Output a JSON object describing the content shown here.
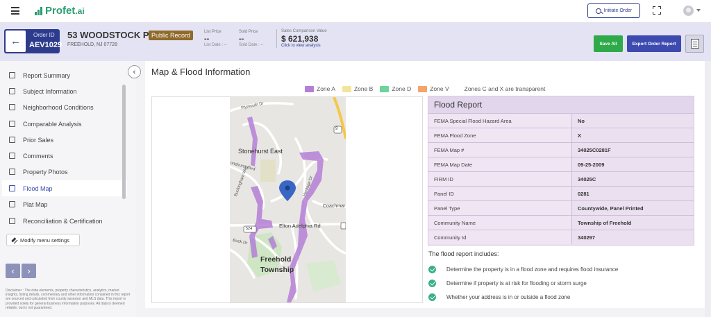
{
  "header": {
    "logo_text": "Profet",
    "logo_suffix": ".ai",
    "initiate_order_label": "Initiate Order"
  },
  "order": {
    "order_id_label": "Order ID",
    "order_id": "AEV1029",
    "address": "53 WOODSTOCK PL",
    "city": "FREEHOLD, NJ 07728",
    "badge": "Public Record",
    "list_price_label": "List Price",
    "list_price_value": "--",
    "list_date_label": "List Date : --",
    "sold_price_label": "Sold Price",
    "sold_price_value": "--",
    "sold_date_label": "Sold Date : --",
    "scv_label": "Sales Comparison Value",
    "scv_value": "$ 621,938",
    "scv_link": "Click to view analysis",
    "save_label": "Save All",
    "export_label": "Export Order Report"
  },
  "sidebar": {
    "items": [
      {
        "label": "Report Summary",
        "icon": "document-icon"
      },
      {
        "label": "Subject Information",
        "icon": "house-icon"
      },
      {
        "label": "Neighborhood Conditions",
        "icon": "neighborhood-icon"
      },
      {
        "label": "Comparable Analysis",
        "icon": "comparable-icon"
      },
      {
        "label": "Prior Sales",
        "icon": "history-icon"
      },
      {
        "label": "Comments",
        "icon": "comment-icon"
      },
      {
        "label": "Property Photos",
        "icon": "photo-icon"
      },
      {
        "label": "Flood Map",
        "icon": "flood-icon"
      },
      {
        "label": "Plat Map",
        "icon": "plat-icon"
      },
      {
        "label": "Reconciliation & Certification",
        "icon": "certificate-icon"
      }
    ],
    "active_index": 7,
    "modify_label": "Modify menu settings",
    "disclaimer": "Disclaimer : The data elements, property characteristics, analytics, market insights, listing details, commentary and other information contained in this report are sourced and calculated from county assessor and MLS data. This report is provided solely for general business information purposes. All data is deemed reliable, but is not guaranteed."
  },
  "main": {
    "title": "Map & Flood Information",
    "legend": [
      {
        "label": "Zone A",
        "color": "#b57fd6"
      },
      {
        "label": "Zone B",
        "color": "#f2e59b"
      },
      {
        "label": "Zone D",
        "color": "#6fd39a"
      },
      {
        "label": "Zone V",
        "color": "#f5a46a"
      }
    ],
    "legend_note": "Zones C and X are transparent",
    "map_labels": {
      "plymouth": "Plymouth Dr",
      "stonehurst": "Stonehurst East",
      "stonehurst_blvd": "onehurst Blvd",
      "buckingham": "Buckingham Way",
      "heritage": "Heritage Dr",
      "coachman": "Coachmar",
      "elton": "Elton Adelphia Rd",
      "route": "524",
      "buck": "Buck Dr",
      "township1": "Freehold",
      "township2": "Township",
      "highway": "9"
    }
  },
  "flood_report": {
    "title": "Flood Report",
    "rows": [
      {
        "label": "FEMA Special Flood Hazard Area",
        "value": "No"
      },
      {
        "label": "FEMA Flood Zone",
        "value": "X"
      },
      {
        "label": "FEMA Map #",
        "value": "34025C0281F"
      },
      {
        "label": "FEMA Map Date",
        "value": "09-25-2009"
      },
      {
        "label": "FIRM ID",
        "value": "34025C"
      },
      {
        "label": "Panel ID",
        "value": "0281"
      },
      {
        "label": "Panel Type",
        "value": "Countywide, Panel Printed"
      },
      {
        "label": "Community Name",
        "value": "Township of Freehold"
      },
      {
        "label": "Community Id",
        "value": "340297"
      }
    ],
    "includes_title": "The flood report includes:",
    "includes": [
      "Determine the property is in a flood zone and requires flood insurance",
      "Determine if property is at risk for flooding or storm surge",
      "Whether your address is in or outside a flood zone"
    ]
  }
}
